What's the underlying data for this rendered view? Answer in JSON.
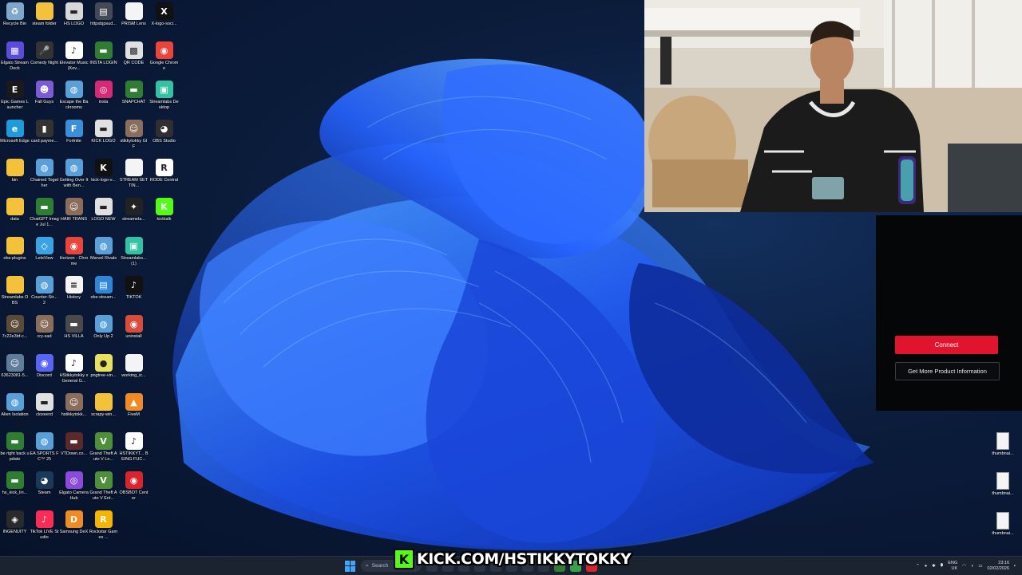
{
  "desktop": {
    "icons": [
      {
        "label": "Recycle Bin",
        "icon": "recycle-bin-icon",
        "color": "#7fa7c9",
        "glyph": "♻"
      },
      {
        "label": "steam folder",
        "icon": "folder-icon",
        "color": "#f3c23a",
        "glyph": ""
      },
      {
        "label": "HS LOGO",
        "icon": "image-file-icon",
        "color": "#d8d8d8",
        "glyph": "▬"
      },
      {
        "label": "httpsbjpsud...",
        "icon": "webpage-icon",
        "color": "#444a55",
        "glyph": "▤"
      },
      {
        "label": "PRISM Lens",
        "icon": "document-icon",
        "color": "#f4f4f4",
        "glyph": ""
      },
      {
        "label": "X-logo-soci...",
        "icon": "x-logo-icon",
        "color": "#111111",
        "glyph": "X"
      },
      {
        "label": "Elgato Stream Deck",
        "icon": "stream-deck-icon",
        "color": "#5b4bdb",
        "glyph": "▦"
      },
      {
        "label": "Comedy Night",
        "icon": "microphone-icon",
        "color": "#333333",
        "glyph": "🎤"
      },
      {
        "label": "Elevator Music (Kev...",
        "icon": "tiktok-file-icon",
        "color": "#ffffff",
        "glyph": "♪"
      },
      {
        "label": "INSTA LOGIN",
        "icon": "image-file-icon",
        "color": "#2e7d32",
        "glyph": "▬"
      },
      {
        "label": "QR CODE",
        "icon": "qr-code-icon",
        "color": "#e0e0e0",
        "glyph": "▩"
      },
      {
        "label": "Google Chrome",
        "icon": "chrome-icon",
        "color": "#e8453c",
        "glyph": "◉"
      },
      {
        "label": "Epic Games Launcher",
        "icon": "epic-games-icon",
        "color": "#1a1a1a",
        "glyph": "E"
      },
      {
        "label": "Fall Guys",
        "icon": "fall-guys-icon",
        "color": "#7b5cd6",
        "glyph": "☻"
      },
      {
        "label": "Escape the Backrooms",
        "icon": "game-globe-icon",
        "color": "#5aa0d8",
        "glyph": "◍"
      },
      {
        "label": "insta",
        "icon": "instagram-icon",
        "color": "#d62976",
        "glyph": "◎"
      },
      {
        "label": "SNAPCHAT",
        "icon": "image-file-icon",
        "color": "#2e7d32",
        "glyph": "▬"
      },
      {
        "label": "Streamlabs Desktop",
        "icon": "streamlabs-icon",
        "color": "#31c3a2",
        "glyph": "▣"
      },
      {
        "label": "Microsoft Edge",
        "icon": "edge-icon",
        "color": "#1f9bd9",
        "glyph": "e"
      },
      {
        "label": "card payme...",
        "icon": "phone-image-icon",
        "color": "#333333",
        "glyph": "▮"
      },
      {
        "label": "Fortnite",
        "icon": "fortnite-icon",
        "color": "#3a8fd8",
        "glyph": "F"
      },
      {
        "label": "KICK LOGO",
        "icon": "image-file-icon",
        "color": "#e0e0e0",
        "glyph": "▬"
      },
      {
        "label": "stikkytokky GIF",
        "icon": "gif-file-icon",
        "color": "#8a6d5a",
        "glyph": "☺"
      },
      {
        "label": "OBS Studio",
        "icon": "obs-icon",
        "color": "#302e31",
        "glyph": "◕"
      },
      {
        "label": "bin",
        "icon": "folder-icon",
        "color": "#f3c23a",
        "glyph": ""
      },
      {
        "label": "Chained Together",
        "icon": "game-globe-icon",
        "color": "#5aa0d8",
        "glyph": "◍"
      },
      {
        "label": "Getting Over It with Ben...",
        "icon": "game-globe-icon",
        "color": "#5aa0d8",
        "glyph": "◍"
      },
      {
        "label": "kick-logo-v...",
        "icon": "kick-logo-icon",
        "color": "#111111",
        "glyph": "K"
      },
      {
        "label": "STREAM SETTIN...",
        "icon": "document-icon",
        "color": "#f4f4f4",
        "glyph": ""
      },
      {
        "label": "RODE Central",
        "icon": "rode-icon",
        "color": "#ffffff",
        "glyph": "R"
      },
      {
        "label": "data",
        "icon": "folder-icon",
        "color": "#f3c23a",
        "glyph": ""
      },
      {
        "label": "ChatGPT Image Jul 1...",
        "icon": "image-file-icon",
        "color": "#2e7d32",
        "glyph": "▬"
      },
      {
        "label": "HAIR TRANS",
        "icon": "photo-icon",
        "color": "#8a6d5a",
        "glyph": "☺"
      },
      {
        "label": "LOGO NEW",
        "icon": "image-file-icon",
        "color": "#e0e0e0",
        "glyph": "▬"
      },
      {
        "label": "streamela...",
        "icon": "streamelements-icon",
        "color": "#222222",
        "glyph": "✦"
      },
      {
        "label": "kicktalk",
        "icon": "kicktalk-icon",
        "color": "#53fc18",
        "glyph": "K"
      },
      {
        "label": "obs-plugins",
        "icon": "folder-icon",
        "color": "#f3c23a",
        "glyph": ""
      },
      {
        "label": "LetsView",
        "icon": "letsview-icon",
        "color": "#3aa3e3",
        "glyph": "◇"
      },
      {
        "label": "Horizon - Chrome",
        "icon": "chrome-icon",
        "color": "#e8453c",
        "glyph": "◉"
      },
      {
        "label": "Marvel Rivals",
        "icon": "game-globe-icon",
        "color": "#5aa0d8",
        "glyph": "◍"
      },
      {
        "label": "Streamlabs... (1)",
        "icon": "streamlabs-icon",
        "color": "#31c3a2",
        "glyph": "▣"
      },
      {
        "label": "",
        "icon": "",
        "color": "",
        "glyph": ""
      },
      {
        "label": "Streamlabs OBS",
        "icon": "folder-icon",
        "color": "#f3c23a",
        "glyph": ""
      },
      {
        "label": "Counter-Str... 2",
        "icon": "game-globe-icon",
        "color": "#5aa0d8",
        "glyph": "◍"
      },
      {
        "label": "History",
        "icon": "document-icon",
        "color": "#f4f4f4",
        "glyph": "≡"
      },
      {
        "label": "obs-stream...",
        "icon": "obs-file-icon",
        "color": "#2f86d6",
        "glyph": "▤"
      },
      {
        "label": "TIKTOK",
        "icon": "tiktok-icon",
        "color": "#111111",
        "glyph": "♪"
      },
      {
        "label": "",
        "icon": "",
        "color": "",
        "glyph": ""
      },
      {
        "label": "7c22e3bf-c...",
        "icon": "photo-icon",
        "color": "#5a4a3a",
        "glyph": "☺"
      },
      {
        "label": "cry-sad",
        "icon": "photo-icon",
        "color": "#8a6d5a",
        "glyph": "☺"
      },
      {
        "label": "HS VILLA",
        "icon": "image-file-icon",
        "color": "#4a4a4a",
        "glyph": "▬"
      },
      {
        "label": "Only Up 2",
        "icon": "game-globe-icon",
        "color": "#5aa0d8",
        "glyph": "◍"
      },
      {
        "label": "uninstall",
        "icon": "uninstall-icon",
        "color": "#d94b3b",
        "glyph": "◉"
      },
      {
        "label": "",
        "icon": "",
        "color": "",
        "glyph": ""
      },
      {
        "label": "63623081-5...",
        "icon": "photo-icon",
        "color": "#5f7c9a",
        "glyph": "☺"
      },
      {
        "label": "Discord",
        "icon": "discord-icon",
        "color": "#5865f2",
        "glyph": "◉"
      },
      {
        "label": "HStikkytokky x General G...",
        "icon": "tiktok-file-icon",
        "color": "#ffffff",
        "glyph": "♪"
      },
      {
        "label": "pngtree-vin...",
        "icon": "image-file-icon",
        "color": "#e8e060",
        "glyph": "●"
      },
      {
        "label": "working_ic...",
        "icon": "document-icon",
        "color": "#f4f4f4",
        "glyph": ""
      },
      {
        "label": "",
        "icon": "",
        "color": "",
        "glyph": ""
      },
      {
        "label": "Alien Isolation",
        "icon": "game-globe-icon",
        "color": "#5aa0d8",
        "glyph": "◍"
      },
      {
        "label": "closeerd",
        "icon": "image-file-icon",
        "color": "#e0e0e0",
        "glyph": "▬"
      },
      {
        "label": "hstikkytokk...",
        "icon": "photo-icon",
        "color": "#8a6d5a",
        "glyph": "☺"
      },
      {
        "label": "scrapy-win...",
        "icon": "folder-icon",
        "color": "#f3c23a",
        "glyph": ""
      },
      {
        "label": "FiveM",
        "icon": "fivem-icon",
        "color": "#f08a24",
        "glyph": "▲"
      },
      {
        "label": "",
        "icon": "",
        "color": "",
        "glyph": ""
      },
      {
        "label": "be right back update",
        "icon": "image-file-icon",
        "color": "#2e7d32",
        "glyph": "▬"
      },
      {
        "label": "EA SPORTS FC™ 25",
        "icon": "game-globe-icon",
        "color": "#5aa0d8",
        "glyph": "◍"
      },
      {
        "label": "VTDown.co...",
        "icon": "image-file-icon",
        "color": "#5a2a2a",
        "glyph": "▬"
      },
      {
        "label": "Grand Theft Auto V Le...",
        "icon": "gta-icon",
        "color": "#4f8f3a",
        "glyph": "V"
      },
      {
        "label": "HSTIKKYT... BEING FUC...",
        "icon": "tiktok-file-icon",
        "color": "#ffffff",
        "glyph": "♪"
      },
      {
        "label": "",
        "icon": "",
        "color": "",
        "glyph": ""
      },
      {
        "label": "hs_kick_lin...",
        "icon": "image-file-icon",
        "color": "#2e7d32",
        "glyph": "▬"
      },
      {
        "label": "Steam",
        "icon": "steam-icon",
        "color": "#1b3a5a",
        "glyph": "◕"
      },
      {
        "label": "Elgato Camera Hub",
        "icon": "camera-hub-icon",
        "color": "#8b4ad9",
        "glyph": "◎"
      },
      {
        "label": "Grand Theft Auto V Ent...",
        "icon": "gta-icon",
        "color": "#4f8f3a",
        "glyph": "V"
      },
      {
        "label": "OBSBOT Center",
        "icon": "obsbot-icon",
        "color": "#d9242c",
        "glyph": "◉"
      },
      {
        "label": "",
        "icon": "",
        "color": "",
        "glyph": ""
      },
      {
        "label": "INGENUITY",
        "icon": "ingenuity-icon",
        "color": "#2a2a2a",
        "glyph": "◈"
      },
      {
        "label": "TikTok LIVE Studio",
        "icon": "tiktok-live-icon",
        "color": "#fe2c55",
        "glyph": "♪"
      },
      {
        "label": "Samsung DeX",
        "icon": "samsung-dex-icon",
        "color": "#f08a24",
        "glyph": "D"
      },
      {
        "label": "Rockstar Games ...",
        "icon": "rockstar-icon",
        "color": "#f5b400",
        "glyph": "R"
      },
      {
        "label": "",
        "icon": "",
        "color": "",
        "glyph": ""
      },
      {
        "label": "",
        "icon": "",
        "color": "",
        "glyph": ""
      }
    ]
  },
  "side_panel": {
    "connect_label": "Connect",
    "info_label": "Get More Product Information"
  },
  "right_files": [
    {
      "label": "thumbnai..."
    },
    {
      "label": "thumbnai..."
    },
    {
      "label": "thumbnai..."
    }
  ],
  "taskbar": {
    "search_placeholder": "Search",
    "lang_top": "ENG",
    "lang_bottom": "UK",
    "time": "23:16",
    "date": "02/02/2026"
  },
  "overlay": {
    "kick_text": "KICK.COM/HSTIKKYTOKKY",
    "kick_logo_glyph": "K"
  },
  "colors": {
    "connect_red": "#e0142c",
    "kick_green": "#53fc18",
    "wallpaper_blue": "#1f5bff"
  }
}
